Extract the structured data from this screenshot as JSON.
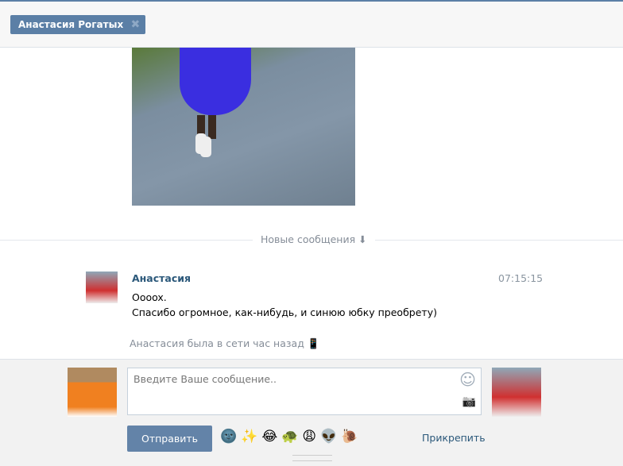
{
  "header": {
    "tab_label": "Анастасия Рогатых",
    "close_icon": "✖"
  },
  "divider": {
    "label": "Новые сообщения ⬇"
  },
  "message": {
    "author": "Анастасия",
    "time": "07:15:15",
    "lines": [
      "Ооoox.",
      "Спасибо огромное, как-нибудь, и синюю юбку преобрету)"
    ]
  },
  "status": "Анастасия была в сети час назад 📱",
  "composer": {
    "placeholder": "Введите Ваше сообщение..",
    "send_label": "Отправить",
    "attach_label": "Прикрепить",
    "emojis": [
      "🌚",
      "✨",
      "😂",
      "🐢",
      "😩",
      "👽",
      "🐌"
    ],
    "smile_icon": "☺",
    "camera_icon": "📷"
  }
}
